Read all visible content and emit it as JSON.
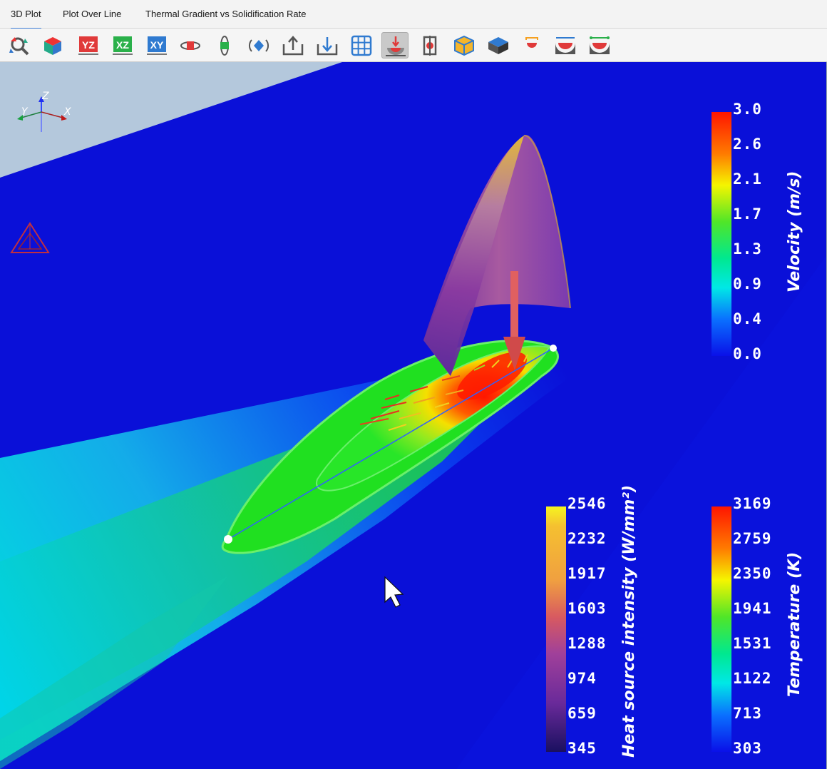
{
  "tabs": [
    {
      "label": "3D Plot",
      "active": true
    },
    {
      "label": "Plot Over Line",
      "active": false
    },
    {
      "label": "Thermal Gradient vs Solidification Rate",
      "active": false
    }
  ],
  "toolbar": [
    {
      "name": "reset-view-icon",
      "label": ""
    },
    {
      "name": "isometric-view-icon",
      "label": ""
    },
    {
      "name": "yz-view-icon",
      "label": "YZ"
    },
    {
      "name": "xz-view-icon",
      "label": "XZ"
    },
    {
      "name": "xy-view-icon",
      "label": "XY"
    },
    {
      "name": "rotate-horizontal-icon",
      "label": ""
    },
    {
      "name": "rotate-vertical-icon",
      "label": ""
    },
    {
      "name": "rotate-in-plane-icon",
      "label": ""
    },
    {
      "name": "export-icon",
      "label": ""
    },
    {
      "name": "import-icon",
      "label": ""
    },
    {
      "name": "grid-icon",
      "label": ""
    },
    {
      "name": "heat-source-icon",
      "label": "",
      "selected": true
    },
    {
      "name": "clip-plane-icon",
      "label": ""
    },
    {
      "name": "box-outline-icon",
      "label": ""
    },
    {
      "name": "box-solid-icon",
      "label": ""
    },
    {
      "name": "melt-pool-small-icon",
      "label": ""
    },
    {
      "name": "melt-pool-width-icon",
      "label": ""
    },
    {
      "name": "melt-pool-depth-icon",
      "label": ""
    }
  ],
  "axes_triad": {
    "x": "X",
    "y": "Y",
    "z": "Z"
  },
  "colorbars": {
    "velocity": {
      "title": "Velocity (m/s)",
      "ticks": [
        "3.0",
        "2.6",
        "2.1",
        "1.7",
        "1.3",
        "0.9",
        "0.4",
        "0.0"
      ]
    },
    "heat_source": {
      "title": "Heat source intensity (W/mm²)",
      "ticks": [
        "2546",
        "2232",
        "1917",
        "1603",
        "1288",
        "974",
        "659",
        "345"
      ]
    },
    "temperature": {
      "title": "Temperature (K)",
      "ticks": [
        "3169",
        "2759",
        "2350",
        "1941",
        "1531",
        "1122",
        "713",
        "303"
      ]
    }
  },
  "colors": {
    "background_blue": "#0a10d8",
    "sky": "#b4c8dc",
    "rainbow": [
      "#ff1500",
      "#ff7a00",
      "#f5f500",
      "#28e628",
      "#00f0e6",
      "#0a5aff",
      "#0a10d8"
    ]
  }
}
